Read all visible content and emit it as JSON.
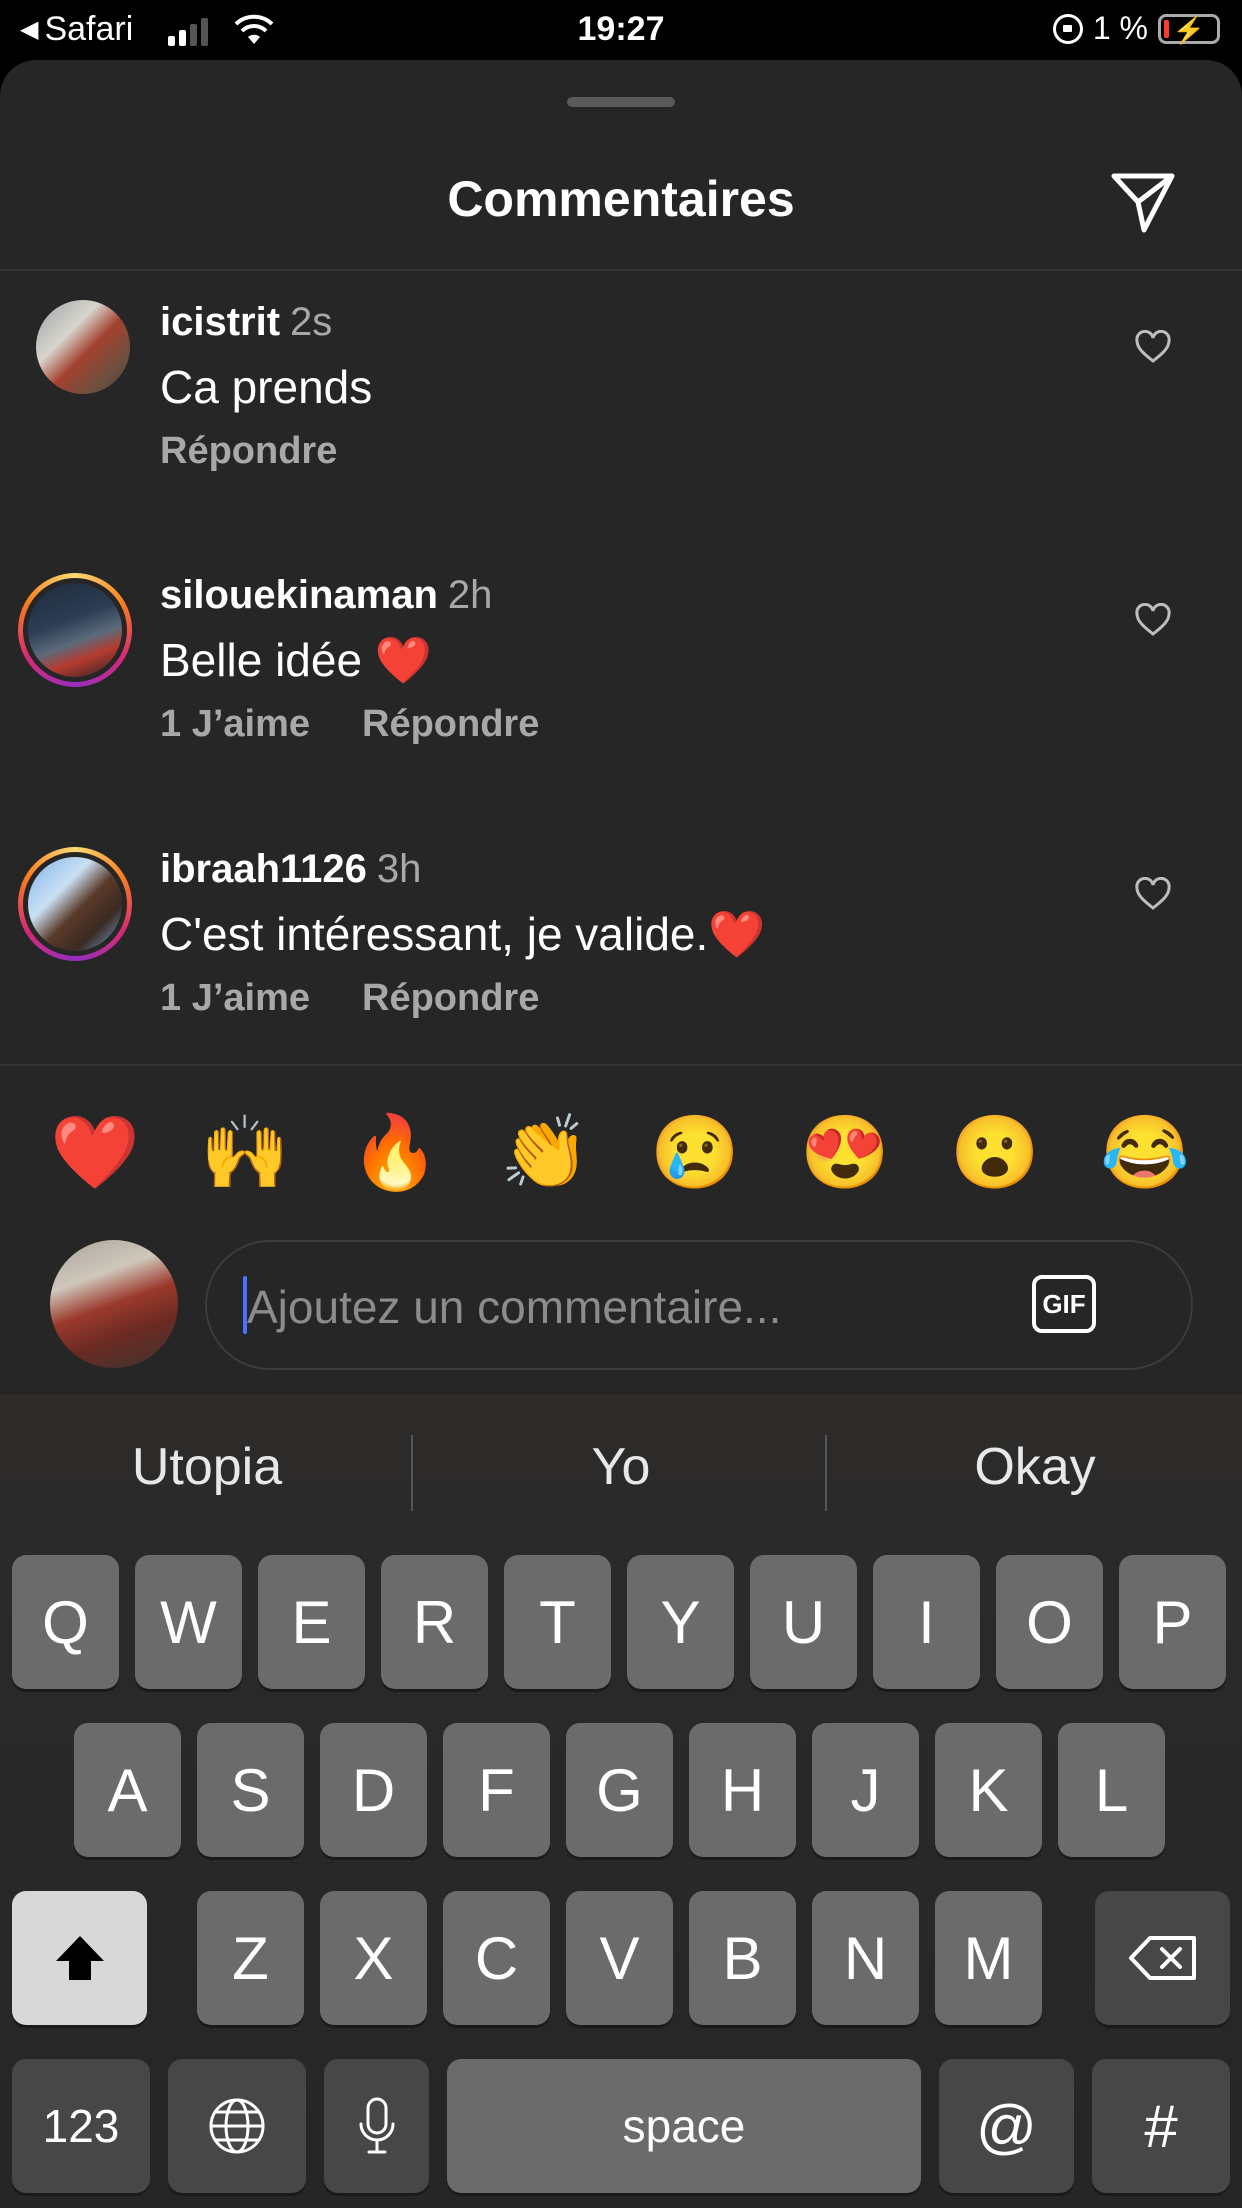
{
  "status_bar": {
    "back_label": "Safari",
    "time": "19:27",
    "battery": "1 %"
  },
  "sheet": {
    "title": "Commentaires"
  },
  "comments": [
    {
      "username": "icistrit",
      "age": "2s",
      "text": "Ca prends",
      "likes": "",
      "reply": "Répondre"
    },
    {
      "username": "silouekinaman",
      "age": "2h",
      "text": "Belle idée ❤️",
      "likes": "1 J’aime",
      "reply": "Répondre"
    },
    {
      "username": "ibraah1126",
      "age": "3h",
      "text": "C'est intéressant, je valide.❤️",
      "likes": "1 J’aime",
      "reply": "Répondre"
    }
  ],
  "reactions": [
    "❤️",
    "🙌",
    "🔥",
    "👏",
    "😢",
    "😍",
    "😮",
    "😂"
  ],
  "composer": {
    "placeholder": "Ajoutez un commentaire...",
    "gif_label": "GIF"
  },
  "keyboard": {
    "suggestions": [
      "Utopia",
      "Yo",
      "Okay"
    ],
    "row1": [
      "Q",
      "W",
      "E",
      "R",
      "T",
      "Y",
      "U",
      "I",
      "O",
      "P"
    ],
    "row2": [
      "A",
      "S",
      "D",
      "F",
      "G",
      "H",
      "J",
      "K",
      "L"
    ],
    "row3": [
      "Z",
      "X",
      "C",
      "V",
      "B",
      "N",
      "M"
    ],
    "numbers_label": "123",
    "space_label": "space",
    "at_label": "@",
    "hash_label": "#"
  }
}
